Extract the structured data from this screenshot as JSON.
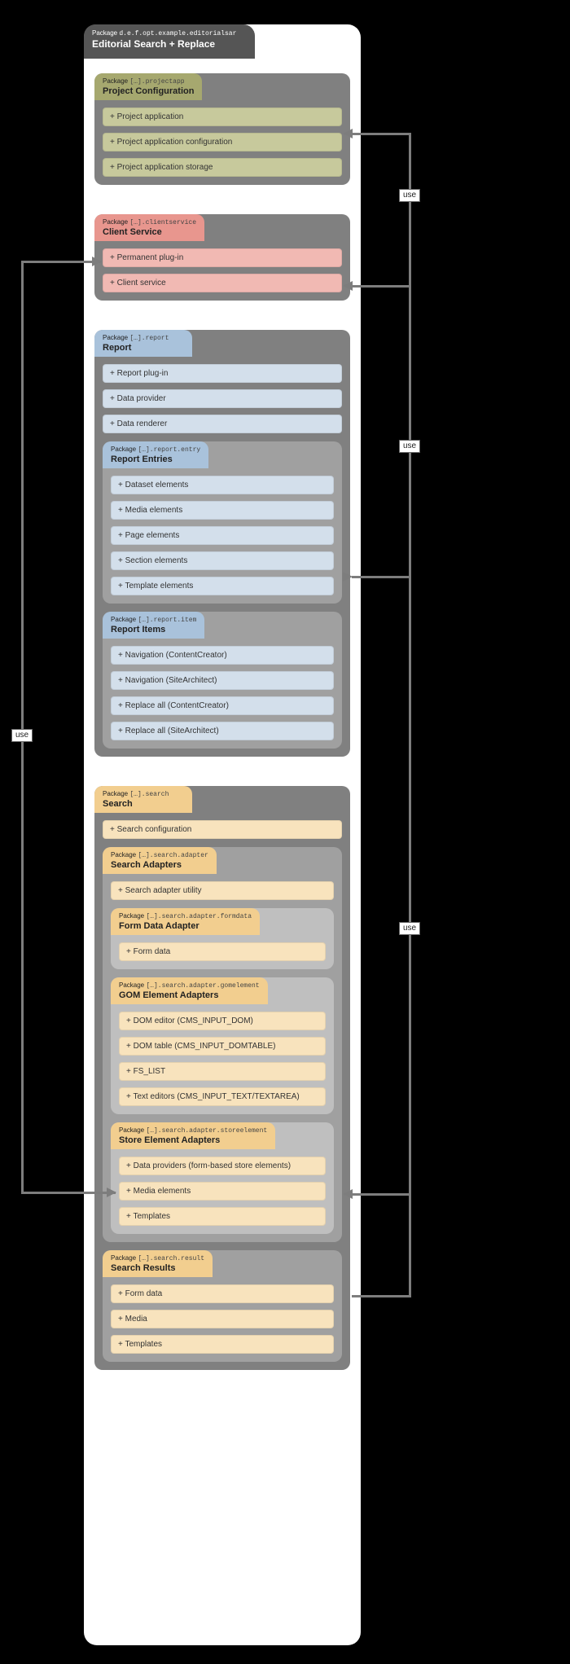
{
  "root": {
    "packageLabel": "Package",
    "packagePath": "d.e.f.opt.example.editorialsar",
    "title": "Editorial Search + Replace"
  },
  "projectapp": {
    "packageLabel": "Package",
    "packagePath": "[…].projectapp",
    "title": "Project Configuration",
    "items": [
      "+ Project application",
      "+ Project application configuration",
      "+ Project application storage"
    ]
  },
  "clientservice": {
    "packageLabel": "Package",
    "packagePath": "[…].clientservice",
    "title": "Client Service",
    "items": [
      "+ Permanent plug-in",
      "+ Client service"
    ]
  },
  "report": {
    "packageLabel": "Package",
    "packagePath": "[…].report",
    "title": "Report",
    "items": [
      "+ Report plug-in",
      "+ Data provider",
      "+ Data renderer"
    ],
    "entry": {
      "packageLabel": "Package",
      "packagePath": "[…].report.entry",
      "title": "Report Entries",
      "items": [
        "+ Dataset elements",
        "+ Media elements",
        "+ Page elements",
        "+ Section elements",
        "+ Template elements"
      ]
    },
    "item": {
      "packageLabel": "Package",
      "packagePath": "[…].report.item",
      "title": "Report Items",
      "items": [
        "+ Navigation (ContentCreator)",
        "+ Navigation (SiteArchitect)",
        "+ Replace all (ContentCreator)",
        "+ Replace all (SiteArchitect)"
      ]
    }
  },
  "search": {
    "packageLabel": "Package",
    "packagePath": "[…].search",
    "title": "Search",
    "items": [
      "+ Search configuration"
    ],
    "adapter": {
      "packageLabel": "Package",
      "packagePath": "[…].search.adapter",
      "title": "Search Adapters",
      "items": [
        "+ Search adapter utility"
      ],
      "formdata": {
        "packageLabel": "Package",
        "packagePath": "[…].search.adapter.formdata",
        "title": "Form Data Adapter",
        "items": [
          "+ Form data"
        ]
      },
      "gomelement": {
        "packageLabel": "Package",
        "packagePath": "[…].search.adapter.gomelement",
        "title": "GOM Element Adapters",
        "items": [
          "+ DOM editor (CMS_INPUT_DOM)",
          "+ DOM table (CMS_INPUT_DOMTABLE)",
          "+ FS_LIST",
          "+ Text editors (CMS_INPUT_TEXT/TEXTAREA)"
        ]
      },
      "storeelement": {
        "packageLabel": "Package",
        "packagePath": "[…].search.adapter.storeelement",
        "title": "Store Element Adapters",
        "items": [
          "+ Data providers (form-based store elements)",
          "+ Media elements",
          "+ Templates"
        ]
      }
    },
    "result": {
      "packageLabel": "Package",
      "packagePath": "[…].search.result",
      "title": "Search Results",
      "items": [
        "+ Form data",
        "+ Media",
        "+ Templates"
      ]
    }
  },
  "labels": {
    "use": "use"
  },
  "colors": {
    "root": "#555555",
    "olive": "#a6a86f",
    "red": "#e8968e",
    "blue": "#a9c2db",
    "orange": "#f2ce8f"
  }
}
